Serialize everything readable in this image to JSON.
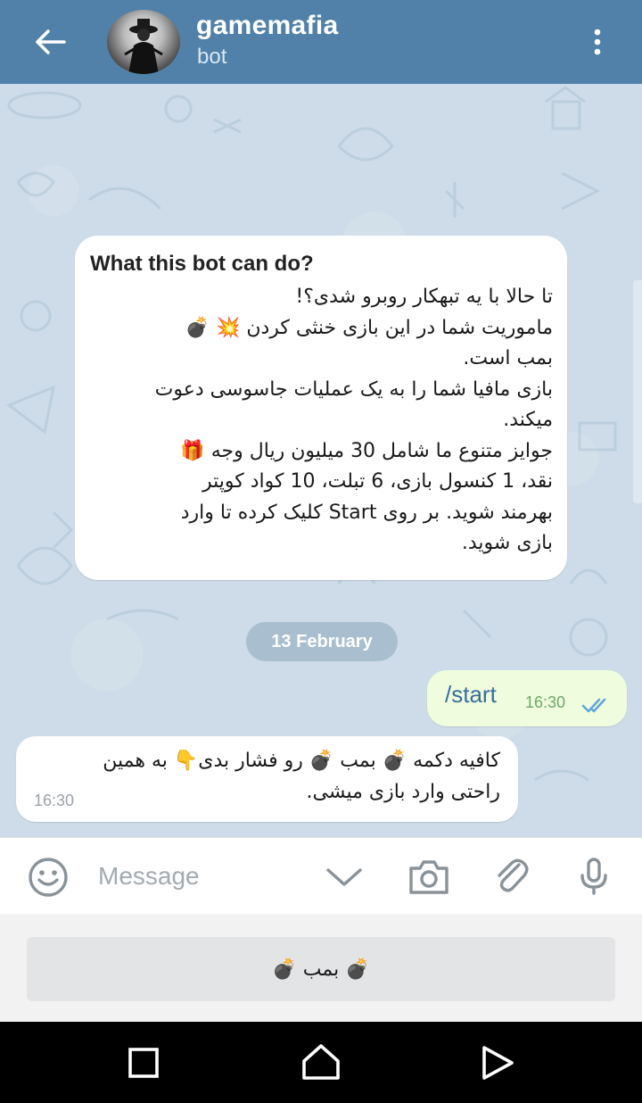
{
  "header": {
    "title": "gamemafia",
    "subtitle": "bot"
  },
  "bot_info": {
    "title": "What this bot can do?",
    "lines": [
      "تا حالا با یه تبهکار روبرو شدی؟!",
      "ماموریت  شما در این بازی خنثی کردن 💥 💣",
      "بمب است.",
      " بازی مافیا شما را به یک عملیات جاسوسی دعوت",
      "میکند.",
      "جوایز متنوع ما شامل 30 میلیون ریال وجه 🎁",
      "نقد، 1 کنسول بازی، 6  تبلت، 10 کواد کوپتر",
      "بهرمند شوید. بر روی Start کلیک کرده تا وارد",
      "بازی شوید."
    ]
  },
  "date_separator": "13 February",
  "outgoing": {
    "text": "/start",
    "time": "16:30"
  },
  "incoming": {
    "lines": [
      "کافیه دکمه 💣 بمب 💣 رو فشار بدی👇 به همین",
      "راحتی وارد بازی میشی."
    ],
    "time": "16:30"
  },
  "composer": {
    "placeholder": "Message"
  },
  "keyboard": {
    "button_label": "💣 بمب 💣"
  },
  "icons": {
    "back": "arrow-left-icon",
    "menu": "more-vert-icon",
    "emoji": "smiley-icon",
    "chevron": "chevron-down-icon",
    "camera": "camera-icon",
    "attach": "paperclip-icon",
    "mic": "microphone-icon",
    "read": "double-check-icon"
  },
  "colors": {
    "header": "#5181a8",
    "outgoing_bubble": "#effdde",
    "chat_background": "#cddce8",
    "link_text": "#3a6d99"
  }
}
